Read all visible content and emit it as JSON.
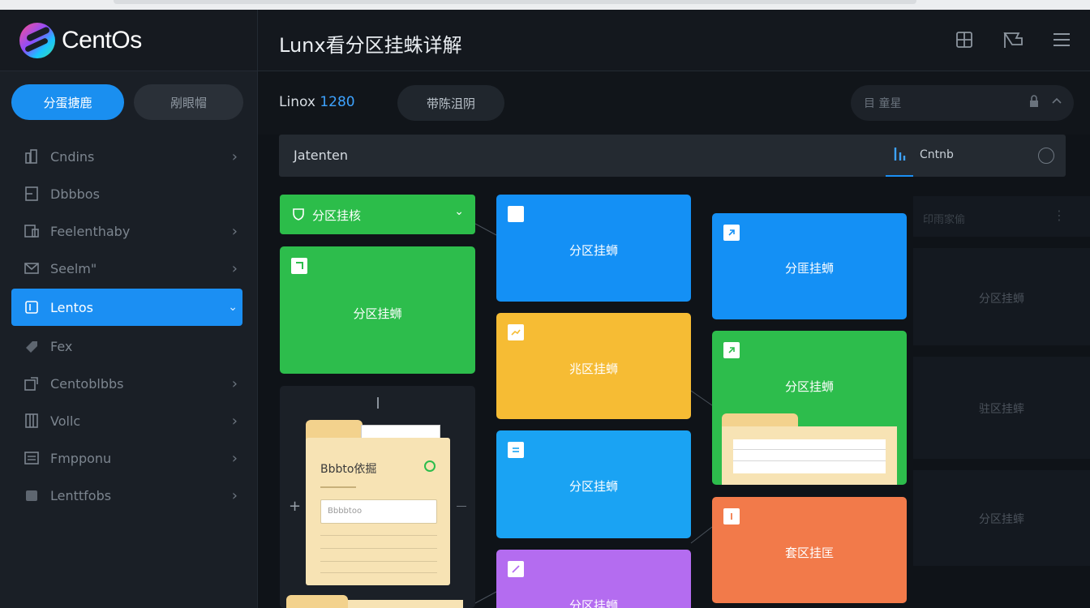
{
  "app": {
    "brand": "CentOs",
    "title": "Lunx看分区挂蛛详解"
  },
  "sidebar": {
    "buttons": {
      "primary": "分蛋搪鹿",
      "secondary": "剐眼帽"
    },
    "items": [
      {
        "label": "Cndins",
        "icon": "building-icon"
      },
      {
        "label": "Dbbbos",
        "icon": "document-icon"
      },
      {
        "label": "Feelenthaby",
        "icon": "image-icon"
      },
      {
        "label": "Seelm\"",
        "icon": "mail-icon"
      },
      {
        "label": "Lentos",
        "icon": "folder-icon"
      },
      {
        "label": "Fex",
        "icon": "tag-icon"
      },
      {
        "label": "Centoblbbs",
        "icon": "export-icon"
      },
      {
        "label": "Vollc",
        "icon": "columns-icon"
      },
      {
        "label": "Fmpponu",
        "icon": "list-icon"
      },
      {
        "label": "Lenttfobs",
        "icon": "disk-icon"
      }
    ]
  },
  "toolbar": {
    "label_prefix": "Linox",
    "label_number": "1280",
    "pill": "带陈沮阴",
    "search_placeholder": "目 童星"
  },
  "bar": {
    "label": "Jatenten",
    "tab_glyph": "J̲",
    "tab_name": "Cntnb"
  },
  "cards": {
    "dropdown": "分区挂核",
    "green_main": "分区挂蛳",
    "blue_top": "分区挂蛳",
    "yellow": "兆区挂蛳",
    "sky": "分区挂蛳",
    "purple": "分区挂蛳",
    "right_blue": "分匪挂蛳",
    "right_green": "分区挂蛳",
    "right_orange": "套区挂匡",
    "doc_title": "Bbbto依掘",
    "doc_field": "Bbbbtoo",
    "ghost_header": "印雨家偷",
    "ghost_1": "分区挂蛳",
    "ghost_2": "驻区挂蟀",
    "ghost_3": "分区挂蟀"
  },
  "colors": {
    "accent": "#1b8ff3",
    "green": "#2dbd4c",
    "blue": "#1490f5",
    "yellow": "#f6bc34",
    "orange": "#f27a4a",
    "purple": "#b46cf0"
  }
}
